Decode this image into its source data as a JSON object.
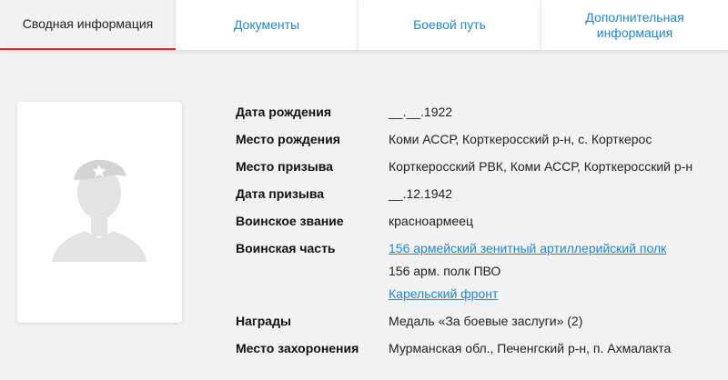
{
  "tabs": [
    {
      "label": "Сводная информация",
      "active": true
    },
    {
      "label": "Документы",
      "active": false
    },
    {
      "label": "Боевой путь",
      "active": false
    },
    {
      "label": "Дополнительная информация",
      "active": false
    }
  ],
  "colors": {
    "accent": "#d9272e",
    "link": "#1e88d4",
    "background": "#f2f2f2"
  },
  "photo": {
    "icon": "soldier-silhouette-icon"
  },
  "info": {
    "birth_date": {
      "label": "Дата рождения",
      "value": "__.__.1922"
    },
    "birth_place": {
      "label": "Место рождения",
      "value": "Коми АССР, Корткеросский р-н, с. Корткерос"
    },
    "draft_place": {
      "label": "Место призыва",
      "value": "Корткеросский РВК, Коми АССР, Корткеросский р-н"
    },
    "draft_date": {
      "label": "Дата призыва",
      "value": "__.12.1942"
    },
    "rank": {
      "label": "Воинское звание",
      "value": "красноармеец"
    },
    "unit": {
      "label": "Воинская часть",
      "link1": "156 армейский зенитный артиллерийский полк",
      "text": "156 арм. полк ПВО",
      "link2": "Карельский фронт"
    },
    "awards": {
      "label": "Награды",
      "value": "Медаль «За боевые заслуги» (2)"
    },
    "burial_place": {
      "label": "Место захоронения",
      "value": "Мурманская обл., Печенгский р-н, п. Ахмалакта"
    }
  }
}
